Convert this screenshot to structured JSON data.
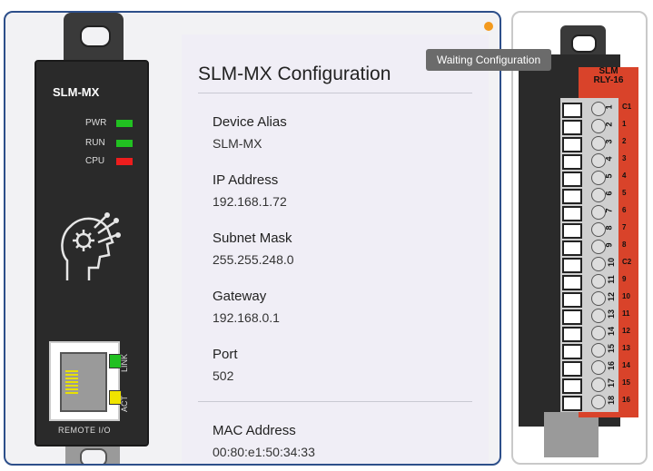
{
  "device": {
    "model": "SLM-MX",
    "leds": [
      {
        "label": "PWR",
        "color": "#21c021"
      },
      {
        "label": "RUN",
        "color": "#21c021"
      },
      {
        "label": "CPU",
        "color": "#ee1d1d"
      }
    ],
    "port_labels": {
      "link": "LINK",
      "act": "ACT",
      "remote": "REMOTE I/O"
    },
    "port_led_colors": {
      "link": "#21c021",
      "act": "#f0e400"
    }
  },
  "status": {
    "dot_color": "#f39a1e",
    "tooltip": "Waiting Configuration"
  },
  "config": {
    "title": "SLM-MX Configuration",
    "fields": [
      {
        "label": "Device Alias",
        "value": "SLM-MX"
      },
      {
        "label": "IP Address",
        "value": "192.168.1.72"
      },
      {
        "label": "Subnet Mask",
        "value": "255.255.248.0"
      },
      {
        "label": "Gateway",
        "value": "192.168.0.1"
      },
      {
        "label": "Port",
        "value": "502"
      },
      {
        "label": "MAC Address",
        "value": "00:80:e1:50:34:33"
      }
    ]
  },
  "relay": {
    "brand_line1": "SLM",
    "brand_line2": "RLY-16",
    "terminals": [
      "1",
      "2",
      "3",
      "4",
      "5",
      "6",
      "7",
      "8",
      "9",
      "10",
      "11",
      "12",
      "13",
      "14",
      "15",
      "16",
      "17",
      "18"
    ],
    "channels": [
      "C1",
      "1",
      "2",
      "3",
      "4",
      "5",
      "6",
      "7",
      "8",
      "C2",
      "9",
      "10",
      "11",
      "12",
      "13",
      "14",
      "15",
      "16"
    ]
  }
}
